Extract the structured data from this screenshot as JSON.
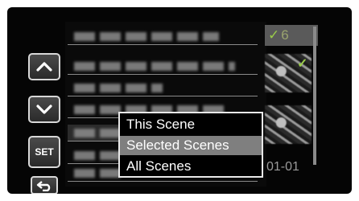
{
  "controls": {
    "set_label": "SET",
    "up_icon": "chevron-up-icon",
    "down_icon": "chevron-down-icon",
    "back_icon": "return-arrow-icon"
  },
  "thumbnails": {
    "count": "6",
    "date_fragment": "01-01"
  },
  "popup_menu": {
    "options": [
      "This Scene",
      "Selected Scenes",
      "All Scenes"
    ],
    "selected": "Selected Scenes"
  },
  "colors": {
    "highlight": "#7f7f7f",
    "check": "#9acb4a"
  }
}
